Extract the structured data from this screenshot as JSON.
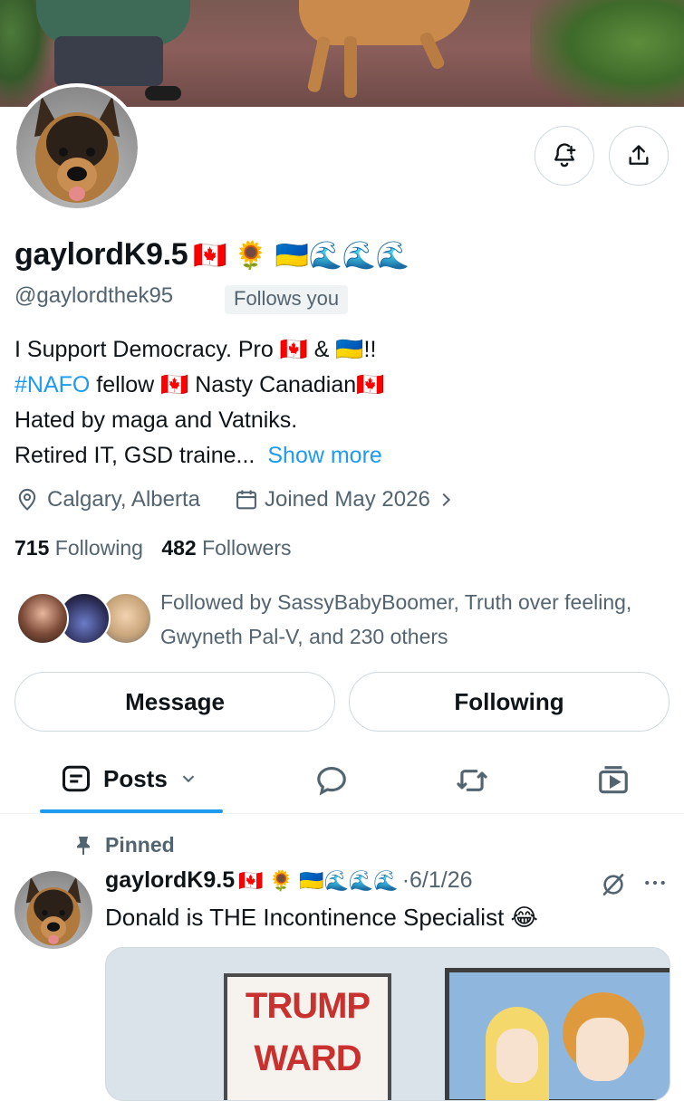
{
  "profile": {
    "display_name": "gaylordK9.5",
    "name_emojis": "🇨🇦 🌻 🇺🇦🌊🌊🌊",
    "handle": "@gaylordthek95",
    "follows_you": "Follows you",
    "bio": {
      "line1_a": "I Support Democracy. Pro ",
      "line1_b": "🇨🇦 & 🇺🇦!!",
      "line2_hashtag": "#NAFO",
      "line2_rest": " fellow 🇨🇦 Nasty Canadian🇨🇦",
      "line3": "Hated by maga and Vatniks.",
      "line4": "Retired IT, GSD traine...",
      "show_more": "Show more"
    },
    "location": "Calgary, Alberta",
    "joined": "Joined May 2026",
    "following_count": "715",
    "following_label": "Following",
    "followers_count": "482",
    "followers_label": "Followers",
    "followed_by": "Followed by SassyBabyBoomer, Truth over feeling, Gwyneth Pal-V, and 230 others"
  },
  "actions": {
    "message": "Message",
    "following": "Following"
  },
  "tabs": {
    "posts": "Posts"
  },
  "post": {
    "pinned_label": "Pinned",
    "author": "gaylordK9.5",
    "author_emojis": "🇨🇦 🌻 🇺🇦🌊🌊🌊",
    "date": "·6/1/26",
    "text": "Donald is THE Incontinence Specialist 😂",
    "image_text_line1": "TRUMP",
    "image_text_line2": "WARD"
  },
  "colors": {
    "accent": "#1d9bf0",
    "secondary_text": "#536471",
    "border": "#cfd9de"
  },
  "icons": [
    "notification-add-icon",
    "share-icon",
    "location-icon",
    "calendar-icon",
    "chevron-right-icon",
    "posts-icon",
    "chevron-down-icon",
    "replies-icon",
    "reposts-icon",
    "media-icon",
    "pin-icon",
    "grok-icon",
    "more-icon"
  ]
}
